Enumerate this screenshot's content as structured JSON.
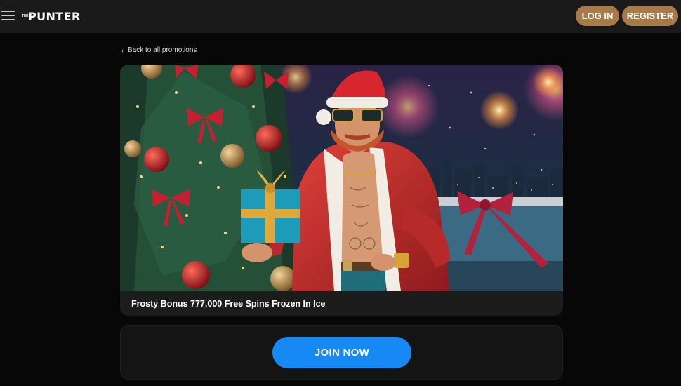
{
  "header": {
    "logo_prefix": "THE",
    "logo_main": "PUNTER",
    "login_label": "LOG IN",
    "register_label": "REGISTER"
  },
  "nav": {
    "back_label": "Back to all promotions"
  },
  "promo": {
    "title": "Frosty Bonus 777,000 Free Spins Frozen In Ice",
    "join_label": "JOIN NOW"
  },
  "colors": {
    "accent_gold": "#a87a4a",
    "join_blue": "#1789f5",
    "page_bg": "#070707",
    "header_bg": "#1a1a1a"
  }
}
